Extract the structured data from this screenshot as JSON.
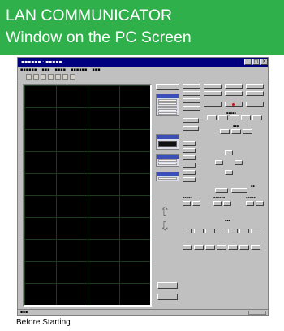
{
  "banner": {
    "title_line1": "LAN COMMUNICATOR",
    "title_line2": "Window on the PC Screen",
    "background_color": "#2fb04a",
    "text_color": "#ffffff"
  },
  "pc_window": {
    "title_bar_color": "#00007f",
    "window_chrome_color": "#c0c0c0",
    "waveform_display_color": "#000000",
    "menu_item_count": 5,
    "toolbar_icons": [
      "new-icon",
      "open-icon",
      "save-icon",
      "print-icon",
      "copy-icon",
      "paste-icon",
      "help-icon"
    ],
    "side_arrows": [
      "arrow-up-icon",
      "arrow-down-icon"
    ],
    "record_indicator_color": "#d01010"
  },
  "caption": {
    "text": "Before Starting"
  }
}
